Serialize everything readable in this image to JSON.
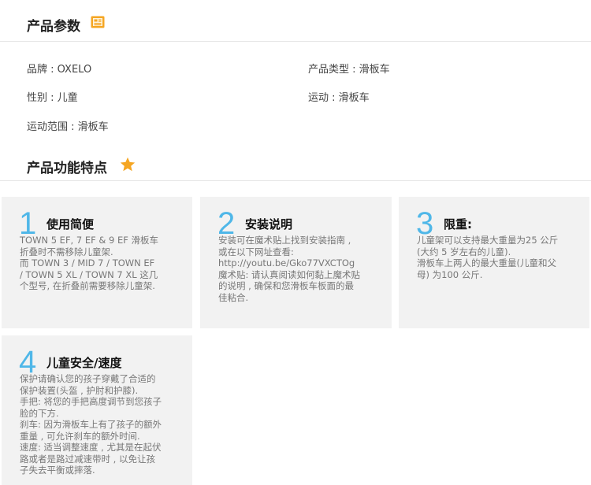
{
  "params_section": {
    "title": "产品参数",
    "icon": "document-icon",
    "items": [
      {
        "label": "品牌 : OXELO"
      },
      {
        "label": "产品类型 : 滑板车"
      },
      {
        "label": "性别 : 儿童"
      },
      {
        "label": "运动 : 滑板车"
      },
      {
        "label": "运动范围 : 滑板车"
      }
    ]
  },
  "features_section": {
    "title": "产品功能特点",
    "icon": "star-icon",
    "accent_color": "#f5a623",
    "number_color": "#4fb7e8",
    "cards": [
      {
        "number": "1",
        "title": "使用简便",
        "lines": [
          "TOWN 5 EF, 7 EF & 9 EF 滑板车",
          "折叠时不需移除儿童架.",
          "而 TOWN 3 / MID 7 / TOWN EF",
          "/ TOWN 5 XL / TOWN 7 XL 这几",
          "个型号, 在折叠前需要移除儿童架."
        ]
      },
      {
        "number": "2",
        "title": "安装说明",
        "lines": [
          "安装可在魔术贴上找到安装指南 ,",
          "或在以下网址查看:",
          "http://youtu.be/Gko77VXCTOg",
          "魔术贴: 请认真阅读如何黏上魔术贴",
          "的说明 , 确保和您滑板车板面的最",
          "佳粘合."
        ]
      },
      {
        "number": "3",
        "title": "限重:",
        "lines": [
          "儿童架可以支持最大重量为25 公斤",
          "(大约 5 岁左右的儿童).",
          "滑板车上两人的最大重量(儿童和父",
          "母) 为100 公斤."
        ]
      },
      {
        "number": "4",
        "title": "儿童安全/速度",
        "lines": [
          "保护请确认您的孩子穿戴了合适的",
          "保护装置(头盔 , 护肘和护膝).",
          "手把: 将您的手把高度调节到您孩子",
          "脸的下方.",
          "刹车: 因为滑板车上有了孩子的额外",
          "重量 , 可允许刹车的额外时间.",
          "速度: 适当调整速度 , 尤其是在起伏",
          "路或者是路过减速带时 , 以免让孩",
          "子失去平衡或摔落."
        ]
      }
    ]
  }
}
